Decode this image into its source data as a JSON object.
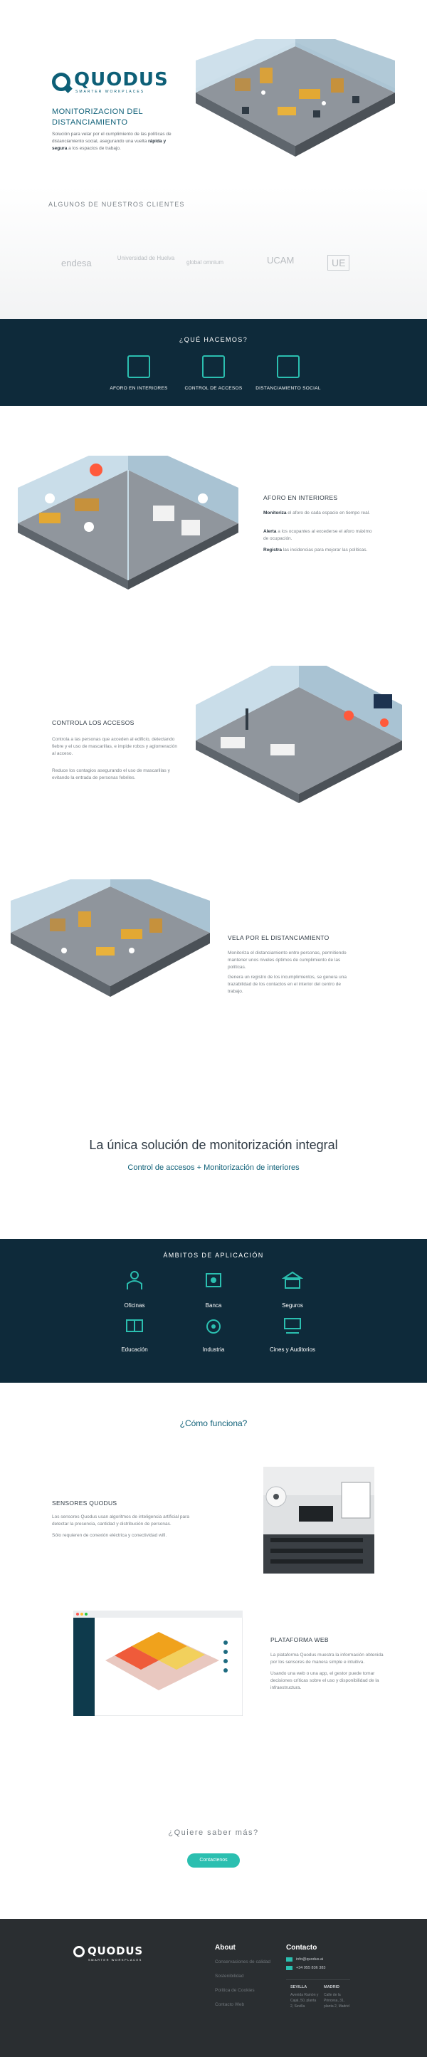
{
  "hero": {
    "brand": "QUODUS",
    "brand_sub": "SMARTER WORKPLACES",
    "title": "MONITORIZACION DEL DISTANCIAMIENTO",
    "desc_pre": "Solución para velar por el cumplimiento de las políticas de distanciamiento social, asegurando una vuelta ",
    "desc_bold": "rápida y segura",
    "desc_post": " a los espacios de trabajo."
  },
  "clients": {
    "title": "ALGUNOS DE NUESTROS CLIENTES",
    "logos": [
      "endesa",
      "Universidad de Huelva",
      "global omnium",
      "UCAM",
      "UE"
    ]
  },
  "services": {
    "title": "¿QUÉ HACEMOS?",
    "items": [
      {
        "label": "AFORO EN INTERIORES",
        "icon": "people-icon"
      },
      {
        "label": "CONTROL DE ACCESOS",
        "icon": "turnstile-icon"
      },
      {
        "label": "DISTANCIAMIENTO SOCIAL",
        "icon": "distance-icon"
      }
    ]
  },
  "aforo": {
    "title": "AFORO EN INTERIORES",
    "p1_bold": "Monitoriza",
    "p1": " el aforo de cada espacio en tiempo real.",
    "p2_bold": "Alerta",
    "p2": " a los ocupantes al excederse el aforo máximo de ocupación.",
    "p3_bold": "Registra",
    "p3": " las incidencias para mejorar las políticas."
  },
  "accesos": {
    "title": "CONTROLA LOS ACCESOS",
    "p1": "Controla a las personas que acceden al edificio, detectando fiebre y el uso de mascarillas, e impide robos y aglomeración al acceso.",
    "p2": "Reduce los contagios asegurando el uso de mascarillas y evitando la entrada de personas febriles."
  },
  "distancia": {
    "title": "VELA POR EL DISTANCIAMIENTO",
    "p1": "Monitoriza el distanciamiento entre personas, permitiendo mantener unos niveles óptimos de cumplimiento de las políticas.",
    "p2": "Genera un registro de los incumplimientos, se genera una trazabilidad de los contactos en el interior del centro de trabajo."
  },
  "integral": {
    "title": "La única solución de monitorización integral",
    "subtitle": "Control de accesos + Monitorización de interiores"
  },
  "ambitos": {
    "title": "ÁMBITOS DE APLICACIÓN",
    "items": [
      {
        "label": "Oficinas",
        "icon": "office-icon"
      },
      {
        "label": "Banca",
        "icon": "bank-icon"
      },
      {
        "label": "Seguros",
        "icon": "insurance-icon"
      },
      {
        "label": "Educación",
        "icon": "education-icon"
      },
      {
        "label": "Industria",
        "icon": "factory-icon"
      },
      {
        "label": "Cines y Auditorios",
        "icon": "cinema-icon"
      }
    ]
  },
  "how": {
    "title": "¿Cómo funciona?",
    "sensors_title": "SENSORES QUODUS",
    "sensors_p1": "Los sensores Quodus usan algoritmos de inteligencia artificial para detectar la presencia, cantidad y distribución de personas.",
    "sensors_p2": "Sólo requieren de conexión eléctrica y conectividad wifi.",
    "web_title": "PLATAFORMA WEB",
    "web_p1": "La plataforma Quodus muestra la información obtenida por los sensores de manera simple e intuitiva.",
    "web_p2": "Usando una web o una app, el gestor puede tomar decisiones críticas sobre el uso y disponibilidad de la infraestructura."
  },
  "cta": {
    "title": "¿Quiere saber más?",
    "button": "Contactenos"
  },
  "footer": {
    "brand": "QUODUS",
    "brand_sub": "SMARTER WORKPLACES",
    "about_title": "About",
    "about_links": [
      "Conservaciones de calidad",
      "Sostenibilidad",
      "Política de Cookies",
      "Contacto Web"
    ],
    "contact_title": "Contacto",
    "email": "info@quodus.ai",
    "phone": "+34 955 836 383",
    "city1": "SEVILLA",
    "addr1": "Avenida Ramón y Cajal, 50, planta 2, Sevilla",
    "city2": "MADRID",
    "addr2": "Calle de la Princesa, 31, planta 2, Madrid"
  }
}
